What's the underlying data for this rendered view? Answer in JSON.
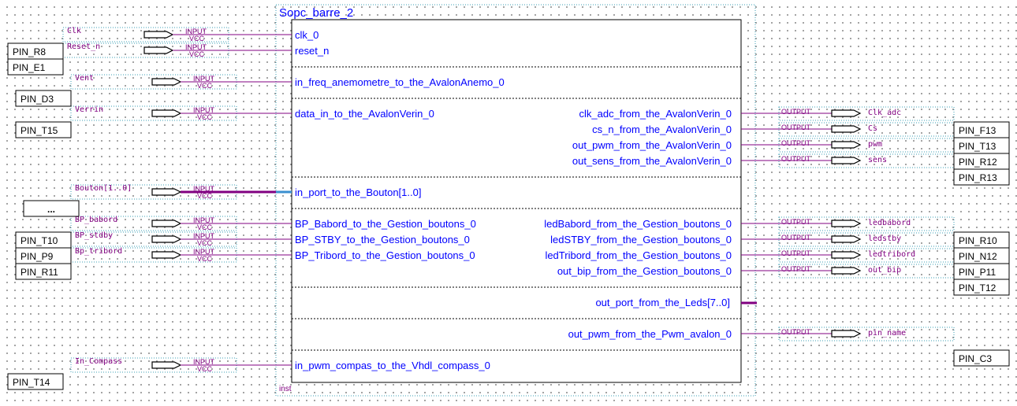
{
  "block": {
    "title": "Sopc_barre_2",
    "inst_label": "inst"
  },
  "port_types": {
    "input": "INPUT",
    "vcc": "VCC",
    "output": "OUTPUT"
  },
  "inputs": [
    {
      "name": "Clk",
      "port": "clk_0"
    },
    {
      "name": "Reset_n",
      "port": "reset_n"
    },
    {
      "name": "Vent",
      "port": "in_freq_anemometre_to_the_AvalonAnemo_0"
    },
    {
      "name": "Verrin",
      "port": "data_in_to_the_AvalonVerin_0"
    },
    {
      "name": "Bouton[1..0]",
      "port": "in_port_to_the_Bouton[1..0]"
    },
    {
      "name": "BP_babord",
      "port": "BP_Babord_to_the_Gestion_boutons_0"
    },
    {
      "name": "BP_stdby",
      "port": "BP_STBY_to_the_Gestion_boutons_0"
    },
    {
      "name": "Bp_tribord",
      "port": "BP_Tribord_to_the_Gestion_boutons_0"
    },
    {
      "name": "In_Compass",
      "port": "in_pwm_compas_to_the_Vhdl_compass_0"
    }
  ],
  "outputs": [
    {
      "port": "clk_adc_from_the_AvalonVerin_0",
      "name": "Clk_adc"
    },
    {
      "port": "cs_n_from_the_AvalonVerin_0",
      "name": "Cs"
    },
    {
      "port": "out_pwm_from_the_AvalonVerin_0",
      "name": "pwm"
    },
    {
      "port": "out_sens_from_the_AvalonVerin_0",
      "name": "sens"
    },
    {
      "port": "ledBabord_from_the_Gestion_boutons_0",
      "name": "ledbabord"
    },
    {
      "port": "ledSTBY_from_the_Gestion_boutons_0",
      "name": "ledstby"
    },
    {
      "port": "ledTribord_from_the_Gestion_boutons_0",
      "name": "ledtribord"
    },
    {
      "port": "out_bip_from_the_Gestion_boutons_0",
      "name": "out_bip"
    },
    {
      "port": "out_pwm_from_the_Pwm_avalon_0",
      "name": "pin_name"
    }
  ],
  "unconnected_port": "out_port_from_the_Leds[7..0]",
  "left_pins": [
    "PIN_R8",
    "PIN_E1",
    "PIN_D3",
    "PIN_T15",
    "...",
    "PIN_T10",
    "PIN_P9",
    "PIN_R11",
    "PIN_T14"
  ],
  "right_pins": [
    "PIN_F13",
    "PIN_T13",
    "PIN_R12",
    "PIN_R13",
    "PIN_R10",
    "PIN_N12",
    "PIN_P11",
    "PIN_T12",
    "PIN_C3"
  ]
}
